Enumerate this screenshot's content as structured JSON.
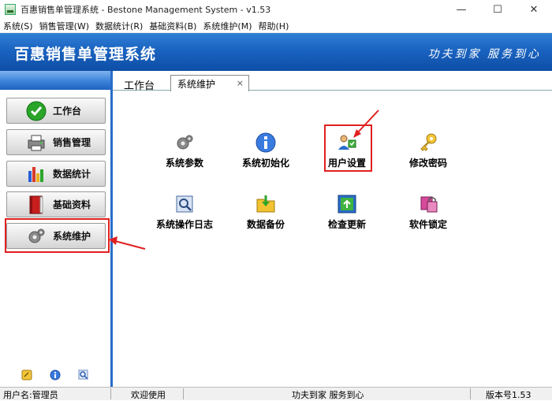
{
  "window": {
    "title": "百惠销售单管理系统 - Bestone Management System - v1.53",
    "controls": [
      "minimize-icon",
      "maximize-icon",
      "close-icon"
    ]
  },
  "menu": [
    {
      "label": "系统(S)"
    },
    {
      "label": "销售管理(W)"
    },
    {
      "label": "数据统计(R)"
    },
    {
      "label": "基础资料(B)"
    },
    {
      "label": "系统维护(M)"
    },
    {
      "label": "帮助(H)"
    }
  ],
  "banner": {
    "title": "百惠销售单管理系统",
    "slogan": "功夫到家 服务到心"
  },
  "sidebar": {
    "items": [
      {
        "label": "工作台",
        "icon": "checkmark-icon"
      },
      {
        "label": "销售管理",
        "icon": "printer-icon"
      },
      {
        "label": "数据统计",
        "icon": "bar-chart-icon"
      },
      {
        "label": "基础资料",
        "icon": "red-book-icon"
      },
      {
        "label": "系统维护",
        "icon": "gear-icon",
        "highlighted": true
      }
    ],
    "footer_icons": [
      "key-icon",
      "info-icon",
      "search-icon"
    ]
  },
  "tabs": [
    {
      "label": "工作台",
      "active": false
    },
    {
      "label": "系统维护",
      "active": true,
      "close": "×"
    }
  ],
  "tools": [
    {
      "label": "系统参数",
      "icon": "gear-icon"
    },
    {
      "label": "系统初始化",
      "icon": "info-icon"
    },
    {
      "label": "用户设置",
      "icon": "users-icon",
      "highlighted": true
    },
    {
      "label": "修改密码",
      "icon": "key-icon"
    },
    {
      "label": "系统操作日志",
      "icon": "log-icon"
    },
    {
      "label": "数据备份",
      "icon": "folder-download-icon"
    },
    {
      "label": "检查更新",
      "icon": "update-icon"
    },
    {
      "label": "软件锁定",
      "icon": "lock-icon"
    }
  ],
  "status": {
    "user": "用户名:管理员",
    "welcome": "欢迎使用",
    "slogan": "功夫到家 服务到心",
    "version": "版本号1.53"
  },
  "colors": {
    "banner": "#1a63c0",
    "sidebar_border": "#2a6cc8",
    "highlight": "#e02020"
  }
}
